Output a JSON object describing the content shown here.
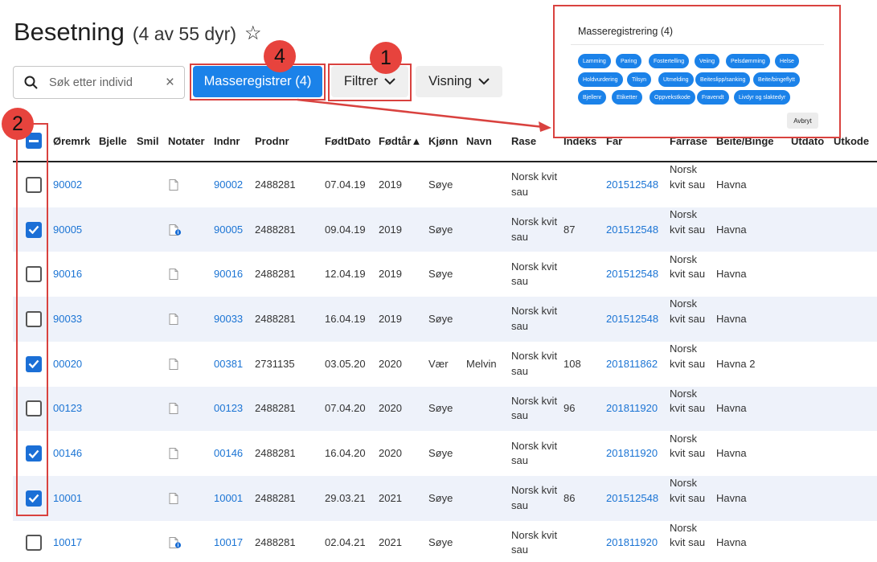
{
  "page": {
    "title": "Besetning",
    "count": "(4 av 55 dyr)"
  },
  "search": {
    "placeholder": "Søk etter individ"
  },
  "toolbar": {
    "mass_label": "Masseregistrer (4)",
    "filter_label": "Filtrer",
    "view_label": "Visning"
  },
  "badges": [
    "4",
    "1",
    "2"
  ],
  "table": {
    "columns": [
      "Øremrk",
      "Bjelle",
      "Smil",
      "Notater",
      "Indnr",
      "Prodnr",
      "FødtDato",
      "Fødtår▲",
      "Kjønn",
      "Navn",
      "Rase",
      "Indeks",
      "Far",
      "Farrase",
      "Beite/Binge",
      "Utdato",
      "Utkode"
    ],
    "rows": [
      {
        "checked": false,
        "oremrk": "90002",
        "note": "plain",
        "indnr": "90002",
        "prodnr": "2488281",
        "fodtdato": "07.04.19",
        "fodtar": "2019",
        "kjonn": "Søye",
        "navn": "",
        "rase": "Norsk kvit sau",
        "indeks": "",
        "far": "201512548",
        "farrase": "Norsk kvit sau",
        "beite": "Havna"
      },
      {
        "checked": true,
        "oremrk": "90005",
        "note": "info",
        "indnr": "90005",
        "prodnr": "2488281",
        "fodtdato": "09.04.19",
        "fodtar": "2019",
        "kjonn": "Søye",
        "navn": "",
        "rase": "Norsk kvit sau",
        "indeks": "87",
        "far": "201512548",
        "farrase": "Norsk kvit sau",
        "beite": "Havna"
      },
      {
        "checked": false,
        "oremrk": "90016",
        "note": "plain",
        "indnr": "90016",
        "prodnr": "2488281",
        "fodtdato": "12.04.19",
        "fodtar": "2019",
        "kjonn": "Søye",
        "navn": "",
        "rase": "Norsk kvit sau",
        "indeks": "",
        "far": "201512548",
        "farrase": "Norsk kvit sau",
        "beite": "Havna"
      },
      {
        "checked": false,
        "oremrk": "90033",
        "note": "plain",
        "indnr": "90033",
        "prodnr": "2488281",
        "fodtdato": "16.04.19",
        "fodtar": "2019",
        "kjonn": "Søye",
        "navn": "",
        "rase": "Norsk kvit sau",
        "indeks": "",
        "far": "201512548",
        "farrase": "Norsk kvit sau",
        "beite": "Havna"
      },
      {
        "checked": true,
        "oremrk": "00020",
        "note": "plain",
        "indnr": "00381",
        "prodnr": "2731135",
        "fodtdato": "03.05.20",
        "fodtar": "2020",
        "kjonn": "Vær",
        "navn": "Melvin",
        "rase": "Norsk kvit sau",
        "indeks": "108",
        "far": "201811862",
        "farrase": "Norsk kvit sau",
        "beite": "Havna 2"
      },
      {
        "checked": false,
        "oremrk": "00123",
        "note": "plain",
        "indnr": "00123",
        "prodnr": "2488281",
        "fodtdato": "07.04.20",
        "fodtar": "2020",
        "kjonn": "Søye",
        "navn": "",
        "rase": "Norsk kvit sau",
        "indeks": "96",
        "far": "201811920",
        "farrase": "Norsk kvit sau",
        "beite": "Havna"
      },
      {
        "checked": true,
        "oremrk": "00146",
        "note": "plain",
        "indnr": "00146",
        "prodnr": "2488281",
        "fodtdato": "16.04.20",
        "fodtar": "2020",
        "kjonn": "Søye",
        "navn": "",
        "rase": "Norsk kvit sau",
        "indeks": "",
        "far": "201811920",
        "farrase": "Norsk kvit sau",
        "beite": "Havna"
      },
      {
        "checked": true,
        "oremrk": "10001",
        "note": "plain",
        "indnr": "10001",
        "prodnr": "2488281",
        "fodtdato": "29.03.21",
        "fodtar": "2021",
        "kjonn": "Søye",
        "navn": "",
        "rase": "Norsk kvit sau",
        "indeks": "86",
        "far": "201512548",
        "farrase": "Norsk kvit sau",
        "beite": "Havna"
      },
      {
        "checked": false,
        "oremrk": "10017",
        "note": "info",
        "indnr": "10017",
        "prodnr": "2488281",
        "fodtdato": "02.04.21",
        "fodtar": "2021",
        "kjonn": "Søye",
        "navn": "",
        "rase": "Norsk kvit sau",
        "indeks": "",
        "far": "201811920",
        "farrase": "Norsk kvit sau",
        "beite": "Havna"
      }
    ]
  },
  "popup": {
    "title": "Masseregistrering (4)",
    "chips": [
      [
        "Lamming",
        "Paring",
        "Fostertelling",
        "Veiing",
        "Pelsdømming",
        "Helse"
      ],
      [
        "Holdvurdering",
        "Tilsyn",
        "Utmelding",
        "Beiteslipp/sanking",
        "Beite/bingeflytt"
      ],
      [
        "Bjellenr",
        "Etiketter",
        "Oppvekstkode",
        "Fravendt",
        "Livdyr og slaktedyr"
      ]
    ],
    "cancel_label": "Avbryt"
  },
  "colors": {
    "primary": "#1b82e9",
    "link": "#1b74d4",
    "annotation": "#e7433d",
    "row_alt": "#eef2fa"
  }
}
